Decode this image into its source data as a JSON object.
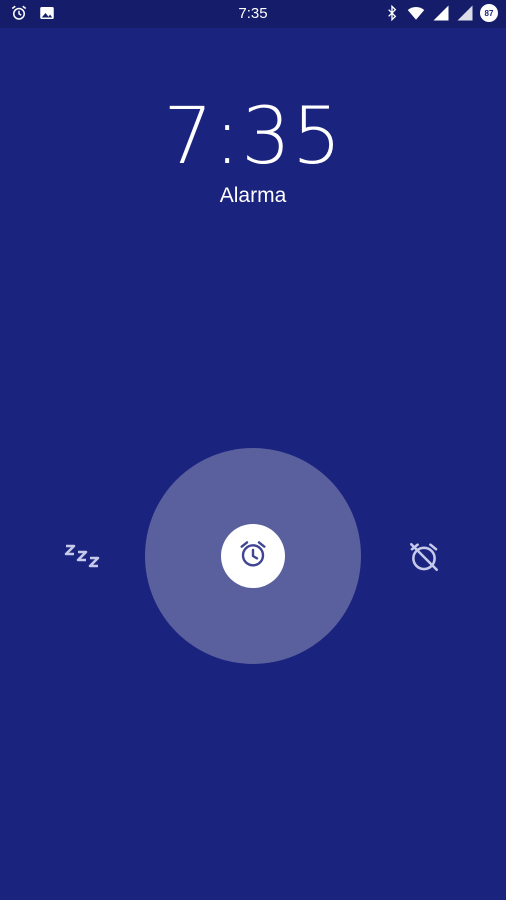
{
  "status_bar": {
    "time": "7:35",
    "battery_level": "87",
    "left_icons": [
      "alarm-icon",
      "image-icon"
    ],
    "right_icons": [
      "bluetooth-icon",
      "wifi-icon",
      "signal-icon",
      "signal-icon",
      "battery-icon"
    ]
  },
  "alarm": {
    "time": "7:35",
    "label": "Alarma"
  },
  "actions": {
    "snooze_icon": "snooze-icon",
    "center_icon": "alarm-clock-icon",
    "dismiss_icon": "alarm-off-icon"
  },
  "colors": {
    "background": "#1a237e",
    "halo": "#5a5f9e",
    "icon_muted": "#c5c9ea"
  }
}
